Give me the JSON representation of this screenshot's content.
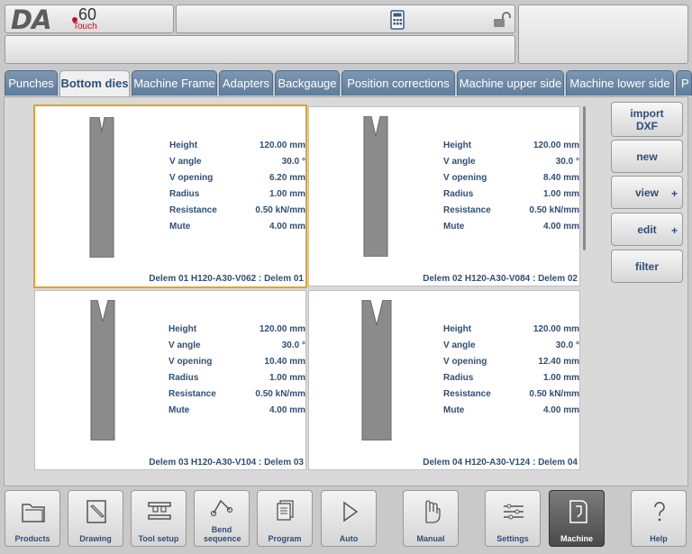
{
  "header": {
    "logo_text": "DA",
    "logo_model": "60",
    "logo_sub": "Touch"
  },
  "tabs": [
    {
      "label": "Punches",
      "active": false
    },
    {
      "label": "Bottom dies",
      "active": true
    },
    {
      "label": "Machine Frame",
      "active": false
    },
    {
      "label": "Adapters",
      "active": false
    },
    {
      "label": "Backgauge",
      "active": false
    },
    {
      "label": "Position corrections",
      "active": false
    },
    {
      "label": "Machine upper side",
      "active": false
    },
    {
      "label": "Machine lower side",
      "active": false
    },
    {
      "label": "P",
      "active": false
    }
  ],
  "props_labels": [
    "Height",
    "V angle",
    "V opening",
    "Radius",
    "Resistance",
    "Mute"
  ],
  "dies": [
    {
      "selected": true,
      "values": [
        "120.00 mm",
        "30.0 °",
        "6.20 mm",
        "1.00 mm",
        "0.50 kN/mm",
        "4.00 mm"
      ],
      "caption": "Delem 01 H120-A30-V062 : Delem 01"
    },
    {
      "selected": false,
      "values": [
        "120.00 mm",
        "30.0 °",
        "8.40 mm",
        "1.00 mm",
        "0.50 kN/mm",
        "4.00 mm"
      ],
      "caption": "Delem 02 H120-A30-V084 : Delem 02"
    },
    {
      "selected": false,
      "values": [
        "120.00 mm",
        "30.0 °",
        "10.40 mm",
        "1.00 mm",
        "0.50 kN/mm",
        "4.00 mm"
      ],
      "caption": "Delem 03 H120-A30-V104 : Delem 03"
    },
    {
      "selected": false,
      "values": [
        "120.00 mm",
        "30.0 °",
        "12.40 mm",
        "1.00 mm",
        "0.50 kN/mm",
        "4.00 mm"
      ],
      "caption": "Delem 04 H120-A30-V124 : Delem 04"
    }
  ],
  "side_buttons": {
    "import_line1": "import",
    "import_line2": "DXF",
    "new": "new",
    "view": "view",
    "edit": "edit",
    "filter": "filter",
    "plus": "+"
  },
  "nav": [
    {
      "label": "Products",
      "icon": "folder-icon"
    },
    {
      "label": "Drawing",
      "icon": "pencil-drawing-icon"
    },
    {
      "label": "Tool setup",
      "icon": "tool-setup-icon"
    },
    {
      "label": "Bend sequence",
      "icon": "bend-sequence-icon"
    },
    {
      "label": "Program",
      "icon": "program-pages-icon"
    },
    {
      "label": "Auto",
      "icon": "play-icon"
    },
    {
      "label": "Manual",
      "icon": "hand-icon"
    },
    {
      "label": "Settings",
      "icon": "settings-list-icon"
    },
    {
      "label": "Machine",
      "icon": "machine-icon"
    },
    {
      "label": "Help",
      "icon": "question-icon"
    }
  ],
  "colors": {
    "accent": "#2f4f78",
    "tab": "#6b88a6",
    "selected_border": "#e8a21f",
    "logo_red": "#c8102e"
  }
}
